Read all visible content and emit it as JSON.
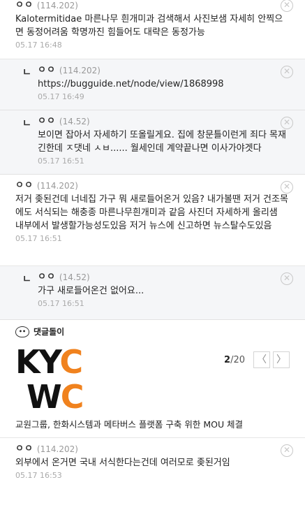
{
  "comments": [
    {
      "nick": "ㅇㅇ",
      "ip": "(114.202)",
      "text": "Kalotermitidae 마른나무 흰개미과 검색해서 사진보샘 자세히 안찍으면 동정어려움 학명까진 힘들어도 대략은 동정가능",
      "time": "05.17 16:48"
    },
    {
      "nick": "ㅇㅇ",
      "ip": "(114.202)",
      "text": "https://bugguide.net/node/view/1868998",
      "time": "05.17 16:49"
    },
    {
      "nick": "ㅇㅇ",
      "ip": "(14.52)",
      "text": "보이면 잡아서 자세하기 또올릴게요. 집에 창문틀이런게 죄다 목재긴한데 ㅈ댓네 ㅅㅂ...... 월세인데 계약끝나면 이사가야겟다",
      "time": "05.17 16:51"
    },
    {
      "nick": "ㅇㅇ",
      "ip": "(114.202)",
      "text": "저거 좆된건데 너네집 가구 뭐 새로들어온거 있음? 내가볼땐 저거 건조목에도 서식되는 해충종 마른나무흰개미과 같음 사진더 자세하게 올리샘 내부에서 발생할가능성도있음 저거 뉴스에 신고하면 뉴스탈수도있음",
      "time": "05.17 16:51"
    },
    {
      "nick": "ㅇㅇ",
      "ip": "(14.52)",
      "text": "가구 새로들어온건 없어요...",
      "time": "05.17 16:51"
    },
    {
      "nick": "ㅇㅇ",
      "ip": "(114.202)",
      "text": "외부에서 온거면 국내 서식한다는건데 여러모로 좆된거임",
      "time": "05.17 16:53"
    }
  ],
  "reply_arrow": "ㄴ",
  "delete_glyph": "✕",
  "ad": {
    "bot_label": "댓글돌이",
    "logo_line1": [
      "KY",
      "C"
    ],
    "logo_line2": [
      "W",
      "C"
    ],
    "pager_current": "2",
    "pager_total": "/20",
    "prev": "〈",
    "next": "〉",
    "title": "교원그룹, 한화시스템과 메타버스 플랫폼 구축 위한 MOU 체결",
    "colors": {
      "accent": "#f0821e",
      "logo_dark": "#111111"
    }
  }
}
